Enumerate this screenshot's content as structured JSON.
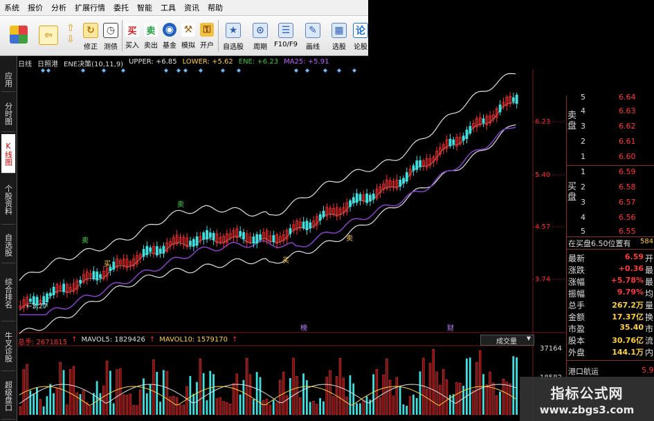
{
  "menu": [
    "系统",
    "报价",
    "分析",
    "扩展行情",
    "委托",
    "智能",
    "工具",
    "资讯",
    "帮助"
  ],
  "toolbar": [
    {
      "label": "",
      "icon": "color-grid-icon",
      "color": "#e04040"
    },
    {
      "label": "",
      "icon": "back-arrow-icon",
      "color": "#f0a020"
    },
    {
      "label": "",
      "icon": "up-down-arrow-icon",
      "color": "#f0a020"
    },
    {
      "label": "修正",
      "icon": "refresh-icon",
      "color": "#f0a020"
    },
    {
      "label": "测债",
      "icon": "clock-icon",
      "color": "#404040"
    },
    {
      "label": "买入",
      "icon": "buy-icon",
      "color": "#d02020"
    },
    {
      "label": "卖出",
      "icon": "sell-icon",
      "color": "#20a040"
    },
    {
      "label": "基金",
      "icon": "fund-icon",
      "color": "#2060c0"
    },
    {
      "label": "模拟",
      "icon": "gavel-icon",
      "color": "#c08020"
    },
    {
      "label": "开户",
      "icon": "lock-icon",
      "color": "#c08020"
    },
    {
      "label": "自选股",
      "icon": "favorite-icon",
      "color": "#3070c0"
    },
    {
      "label": "周期",
      "icon": "period-icon",
      "color": "#3070c0"
    },
    {
      "label": "F10/F9",
      "icon": "f10-icon",
      "color": "#3070c0"
    },
    {
      "label": "画线",
      "icon": "pencil-icon",
      "color": "#3070c0"
    },
    {
      "label": "选股",
      "icon": "screener-icon",
      "color": "#3070c0"
    },
    {
      "label": "论股",
      "icon": "forum-icon",
      "color": "#2070d0"
    }
  ],
  "left_tabs": [
    {
      "label": "应用",
      "active": false
    },
    {
      "label": "分时图",
      "active": false
    },
    {
      "label": "K线图",
      "active": true
    },
    {
      "label": "个股资料",
      "active": false
    },
    {
      "label": "自选股",
      "active": false
    },
    {
      "label": "综合排名",
      "active": false
    },
    {
      "label": "牛叉诊股",
      "active": false
    },
    {
      "label": "超级盘口",
      "active": false
    }
  ],
  "indicator_line": {
    "period": "日线",
    "name": "日照港",
    "ind": "ENE决策(10,11,9)",
    "upper": "UPPER: +6.85",
    "lower": "LOWER: +5.62",
    "ene": "ENE: +6.23",
    "ma25": "MA25: +5.91"
  },
  "colors": {
    "up": "#ff3030",
    "down": "#40e0e0",
    "band": "#e0e0e0",
    "ma": "#8040c0",
    "axis": "#ff3030",
    "grid": "#7a1818"
  },
  "price_axis": [
    "6.23",
    "5.40",
    "4.57",
    "3.74"
  ],
  "annotations": {
    "low_label": "←3.27",
    "buy": "买",
    "sell": "卖",
    "mark1": "榜",
    "mark2": "财"
  },
  "volume": {
    "total": "总手: 2671815",
    "mavol5": "MAVOL5: 1829426",
    "mavol10": "MAVOL10: 1579170",
    "selector": "成交量",
    "axis_top": "37164",
    "axis_mid": "18582"
  },
  "order_book": {
    "sell_label": "卖盘",
    "buy_label": "买盘",
    "sell": [
      {
        "n": "5",
        "p": "6.64",
        "v": ""
      },
      {
        "n": "4",
        "p": "6.63",
        "v": ""
      },
      {
        "n": "3",
        "p": "6.62",
        "v": ""
      },
      {
        "n": "2",
        "p": "6.61",
        "v": ""
      },
      {
        "n": "1",
        "p": "6.60",
        "v": ""
      }
    ],
    "buy": [
      {
        "n": "1",
        "p": "6.59",
        "v": ""
      },
      {
        "n": "2",
        "p": "6.58",
        "v": ""
      },
      {
        "n": "3",
        "p": "6.57",
        "v": ""
      },
      {
        "n": "4",
        "p": "6.56",
        "v": ""
      },
      {
        "n": "5",
        "p": "6.55",
        "v": ""
      }
    ],
    "position_line": "在买盘6.50位置有",
    "position_vol": "584"
  },
  "stats": [
    {
      "k": "最新",
      "v": "6.59",
      "x": "开",
      "color": "#ff3a3a"
    },
    {
      "k": "涨跌",
      "v": "+0.36",
      "x": "最",
      "color": "#ff3a3a"
    },
    {
      "k": "涨幅",
      "v": "+5.78%",
      "x": "最",
      "color": "#ff3a3a"
    },
    {
      "k": "振幅",
      "v": "9.79%",
      "x": "均",
      "color": "#ff3a3a"
    },
    {
      "k": "总手",
      "v": "267.2万",
      "x": "量",
      "color": "#ffd040"
    },
    {
      "k": "金额",
      "v": "17.37亿",
      "x": "换",
      "color": "#ffd040"
    },
    {
      "k": "市盈",
      "v": "35.40",
      "x": "市",
      "color": "#ffd040"
    },
    {
      "k": "股本",
      "v": "30.76亿",
      "x": "流",
      "color": "#ffd040"
    },
    {
      "k": "外盘",
      "v": "144.1万",
      "x": "内",
      "color": "#ffd040"
    }
  ],
  "sector": {
    "name": "港口航运",
    "val": "5.9"
  },
  "watermark": {
    "title": "指标公式网",
    "url": "www.zbgs3.com"
  }
}
